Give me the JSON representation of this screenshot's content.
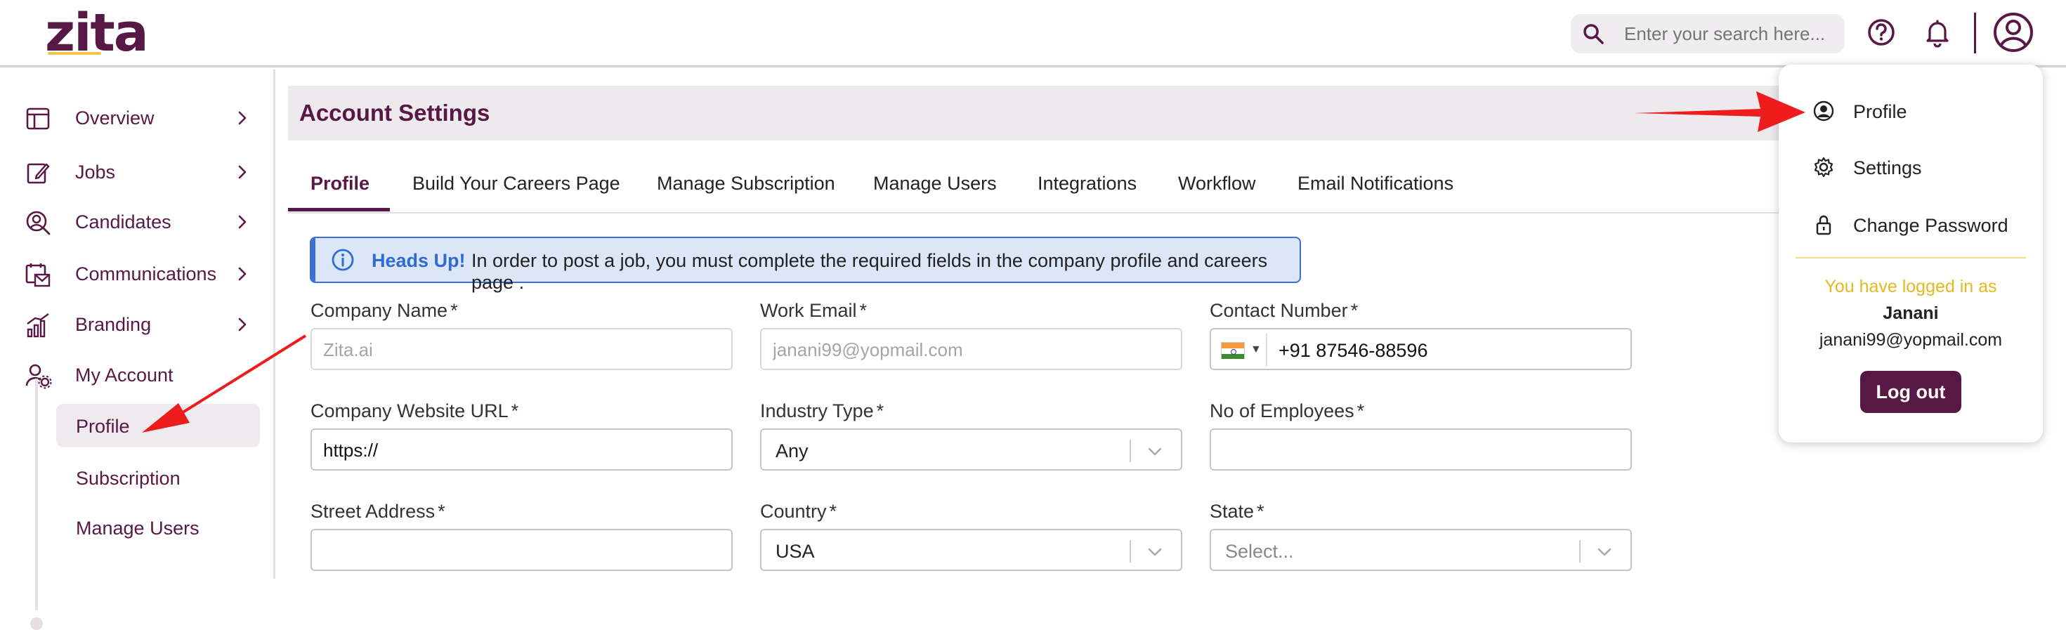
{
  "brand": {
    "logo_text": "zita",
    "primary_color": "#581845",
    "accent_color": "#eec643"
  },
  "header": {
    "search_placeholder": "Enter your search here...",
    "icons": [
      "search-icon",
      "help-icon",
      "bell-icon",
      "user-avatar-icon"
    ]
  },
  "sidebar": {
    "items": [
      {
        "label": "Overview",
        "icon": "overview-icon"
      },
      {
        "label": "Jobs",
        "icon": "jobs-icon"
      },
      {
        "label": "Candidates",
        "icon": "candidates-icon"
      },
      {
        "label": "Communications",
        "icon": "communications-icon"
      },
      {
        "label": "Branding",
        "icon": "branding-icon"
      },
      {
        "label": "My Account",
        "icon": "account-icon"
      }
    ],
    "subitems": [
      {
        "label": "Profile",
        "active": true
      },
      {
        "label": "Subscription"
      },
      {
        "label": "Manage Users"
      }
    ]
  },
  "page": {
    "title": "Account Settings",
    "tabs": [
      "Profile",
      "Build Your Careers Page",
      "Manage Subscription",
      "Manage Users",
      "Integrations",
      "Workflow",
      "Email Notifications"
    ],
    "active_tab": "Profile",
    "alert": {
      "title": "Heads Up!",
      "text": "In order to post a job, you must complete the required fields in the company profile and careers page ."
    }
  },
  "form": {
    "company_name": {
      "label": "Company Name",
      "required": "*",
      "placeholder": "Zita.ai"
    },
    "work_email": {
      "label": "Work Email",
      "required": "*",
      "placeholder": "janani99@yopmail.com"
    },
    "contact_number": {
      "label": "Contact Number",
      "required": "*",
      "value": "+91 87546-88596",
      "flag": "India"
    },
    "website": {
      "label": "Company Website URL",
      "required": "*",
      "value": "https://"
    },
    "industry": {
      "label": "Industry Type",
      "required": "*",
      "value": "Any"
    },
    "employees": {
      "label": "No of Employees",
      "required": "*",
      "value": ""
    },
    "street": {
      "label": "Street Address",
      "required": "*",
      "value": ""
    },
    "country": {
      "label": "Country",
      "required": "*",
      "value": "USA"
    },
    "state": {
      "label": "State",
      "required": "*",
      "placeholder": "Select..."
    }
  },
  "user_menu": {
    "items": [
      {
        "label": "Profile",
        "icon": "user-circle-icon"
      },
      {
        "label": "Settings",
        "icon": "gear-icon"
      },
      {
        "label": "Change Password",
        "icon": "lock-icon"
      }
    ],
    "logged_in_prefix": "You have logged in as",
    "user_name": "Janani",
    "user_email": "janani99@yopmail.com",
    "logout_label": "Log out",
    "logged_text_color": "#e5b720"
  },
  "annotation_color": "#ee1c1c"
}
